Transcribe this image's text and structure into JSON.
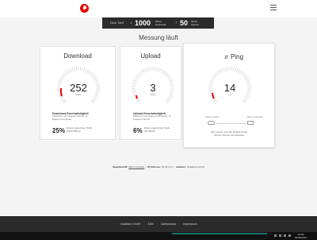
{
  "tariff": {
    "label": "Dein Tarif",
    "download_value": "1000",
    "download_unit_top": "Mbit/s",
    "download_unit_bottom": "Download",
    "upload_value": "50",
    "upload_unit_top": "Mbit/s",
    "upload_unit_bottom": "Upload"
  },
  "page_title": "Messung läuft",
  "download": {
    "title": "Download",
    "value": "252",
    "unit": "Mbit/s",
    "desc_title": "Download-Geschwindigkeit",
    "desc_line1": "Zwischen von unserem Server zu",
    "desc_line2": "Deinem Computer",
    "percent": "25%",
    "percent_desc_line1": "Deines gebuchten Tarifs",
    "percent_desc_line2": "(1000 Mbit/s)"
  },
  "upload": {
    "title": "Upload",
    "value": "3",
    "unit": "Mbit/s",
    "desc_title": "Upload-Geschwindigkeit",
    "desc_line1": "Zwischen von Deinem Computer zu",
    "desc_line2": "unserem Server",
    "percent": "6%",
    "percent_desc_line1": "Deines gebuchten Tarifs",
    "percent_desc_line2": "(50 Mbit/s)"
  },
  "ping": {
    "title": "Ping",
    "value": "14",
    "unit": "ms",
    "left_label": "Unser Server",
    "right_label": "Dein Computer",
    "text_line1": "Wir messen jetzt die Reaktionszeit",
    "text_line2": "Deines internen Anschlusses"
  },
  "footer_info": {
    "speedtest_label": "Speedtest-ID:",
    "speedtest_value": "b8mLrxpTqpzg",
    "ip_label": "IP-Adresse:",
    "ip_value": "91.18.3.xx",
    "provider_label": "Anbieter:",
    "provider_value": "Vodafone GmbH"
  },
  "footer_links": [
    "Vodafone GmbH",
    "AGB",
    "Datenschutz",
    "Impressum"
  ],
  "taskbar": {
    "time": "10:46",
    "date": "20/05/2021"
  },
  "colors": {
    "brand": "#e60000",
    "dark": "#2b2b2b",
    "gauge_tick": "#cccccc"
  }
}
